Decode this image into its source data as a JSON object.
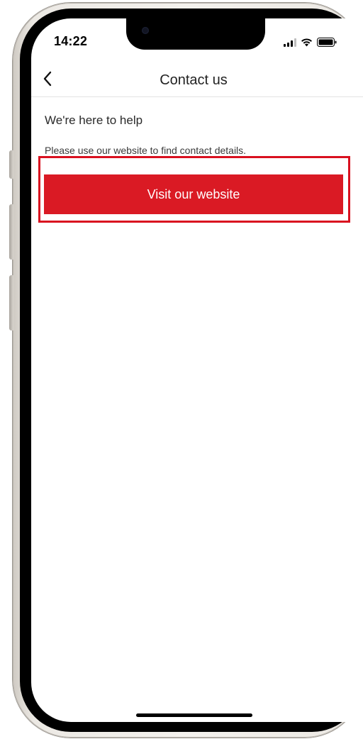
{
  "status_bar": {
    "time": "14:22",
    "icons": [
      "signal-icon",
      "wifi-icon",
      "battery-icon"
    ]
  },
  "nav": {
    "back_icon": "chevron-left-icon",
    "title": "Contact us"
  },
  "content": {
    "heading": "We're here to help",
    "help_text": "Please use our website to find contact details.",
    "visit_button_label": "Visit our website"
  },
  "colors": {
    "accent": "#da1a24",
    "highlight_border": "#d9101f",
    "background": "#ffffff",
    "text": "#222222"
  }
}
